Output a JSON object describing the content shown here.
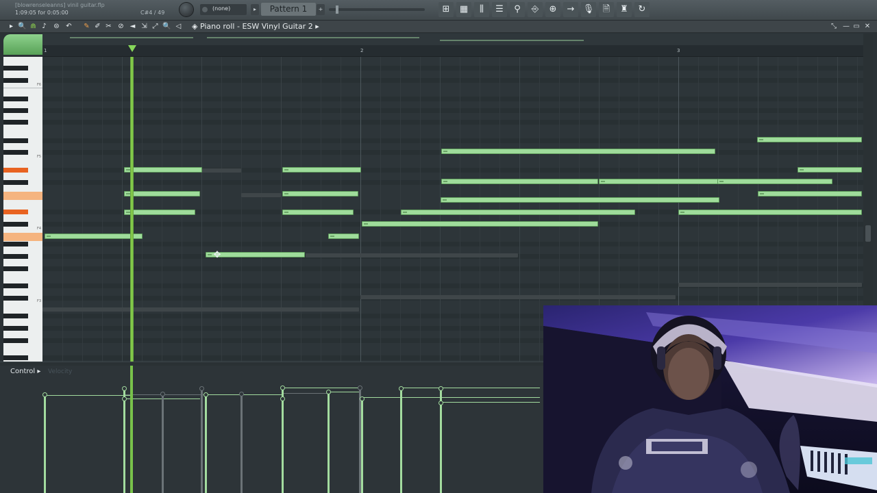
{
  "app": {
    "project_line": "[blowrenseleanns] vinil guitar.flp",
    "time_line": "1:09:05 for 0:05:00",
    "hint": "C#4 / 49",
    "plugin_box": "(none)",
    "pattern": "Pattern 1",
    "add_symbol": "+"
  },
  "toolbar_icons": [
    "pianoroll-icon",
    "playlist-icon",
    "mixer-icon",
    "channelrack-icon",
    "plugin-icon",
    "routing-icon",
    "browser-icon",
    "next-icon",
    "mic-icon",
    "file-icon",
    "hat-icon",
    "refresh-icon"
  ],
  "toolbar_glyphs": [
    "⊞",
    "▦",
    "⫼",
    "☰",
    "⚲",
    "⎆",
    "⊕",
    "→",
    "🎙",
    "🗎",
    "♜",
    "↻"
  ],
  "piano_roll": {
    "title": "Piano roll - ESW Vinyl Guitar 2",
    "arrow": "▸",
    "tools": [
      "▸",
      "🔍",
      "⋒",
      "♪",
      "⊜",
      "↶",
      "✎",
      "✐",
      "✂",
      "⊘",
      "◄",
      "⇲",
      "⤢",
      "🔍",
      "◁"
    ],
    "window_controls": [
      "⤡",
      "—",
      "▭",
      "✕"
    ]
  },
  "ruler": {
    "bars": [
      "1",
      "2",
      "3"
    ]
  },
  "keyboard": {
    "labels": [
      "F6",
      "F5",
      "F4",
      "F3"
    ]
  },
  "control": {
    "label": "Control",
    "arrow": "▸",
    "target": "Velocity"
  },
  "colors": {
    "note_fill": "#9fdc9b",
    "playhead": "#8fd64e",
    "highlight_key": "#e86321",
    "grid_bg": "#2d3539"
  }
}
